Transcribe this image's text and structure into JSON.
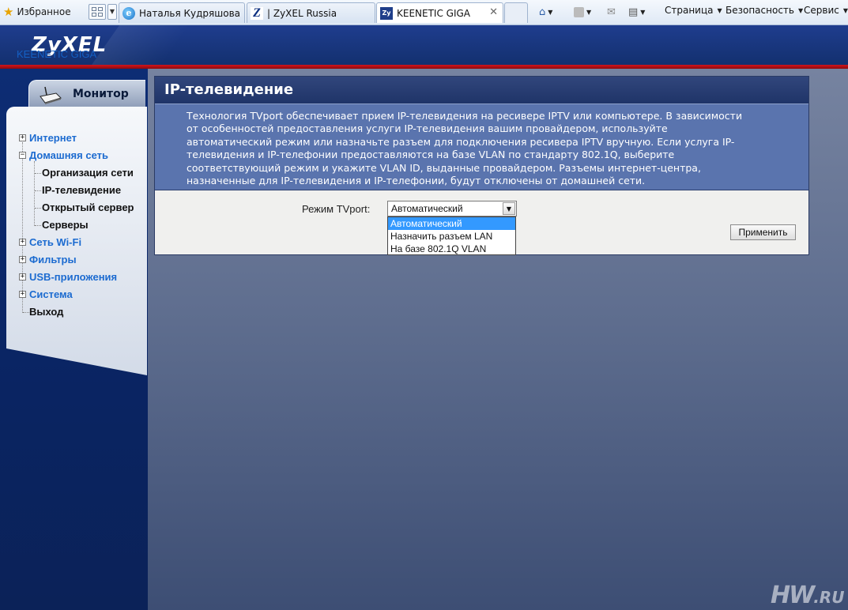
{
  "browser": {
    "favorites_label": "Избранное",
    "tabs": [
      {
        "label": "Наталья Кудряшова",
        "icon": "ie-page-icon"
      },
      {
        "label": "| ZyXEL Russia",
        "icon": "zyxel-z-icon"
      },
      {
        "label": "KEENETIC GIGA",
        "icon": "zyxel-favicon",
        "active": true
      }
    ],
    "menus": [
      "Страница",
      "Безопасность",
      "Сервис"
    ]
  },
  "header": {
    "logo": "ZyXEL"
  },
  "sidebar": {
    "monitor_tab": "Монитор",
    "device": "KEENETIC GIGA",
    "items": [
      {
        "label": "Интернет",
        "expandable": true,
        "expanded": false
      },
      {
        "label": "Домашняя сеть",
        "expandable": true,
        "expanded": true
      },
      {
        "label": "Организация сети",
        "level": 2
      },
      {
        "label": "IP-телевидение",
        "level": 2,
        "current": true
      },
      {
        "label": "Открытый сервер",
        "level": 2
      },
      {
        "label": "Серверы",
        "level": 2
      },
      {
        "label": "Сеть Wi-Fi",
        "expandable": true,
        "expanded": false
      },
      {
        "label": "Фильтры",
        "expandable": true,
        "expanded": false
      },
      {
        "label": "USB-приложения",
        "expandable": true,
        "expanded": false
      },
      {
        "label": "Система",
        "expandable": true,
        "expanded": false
      },
      {
        "label": "Выход",
        "expandable": false
      }
    ]
  },
  "content": {
    "title": "IP-телевидение",
    "description_lines": [
      "Технология TVport обеспечивает прием IP-телевидения на ресивере IPTV или компьютере. В зависимости",
      "от особенностей предоставления услуги IP-телевидения вашим провайдером, используйте",
      "автоматический режим или назначьте разъем для подключения ресивера IPTV вручную. Если услуга IP-",
      "телевидения и IP-телефонии предоставляются на базе VLAN по стандарту 802.1Q, выберите",
      "соответствующий режим и укажите VLAN ID, выданные провайдером. Разъемы интернет-центра,",
      "назначенные для IP-телевидения и IP-телефонии, будут отключены от домашней сети."
    ],
    "mode_label": "Режим TVport:",
    "mode_value": "Автоматический",
    "mode_options": [
      "Автоматический",
      "Назначить разъем LAN",
      "На базе 802.1Q VLAN"
    ],
    "apply_button": "Применить"
  },
  "watermark": {
    "main": "HW",
    "suffix": ".RU"
  },
  "colors": {
    "brand_blue": "#13306f",
    "brand_red": "#d2141b",
    "link_blue": "#1c6bd0",
    "selection": "#3399ff"
  }
}
